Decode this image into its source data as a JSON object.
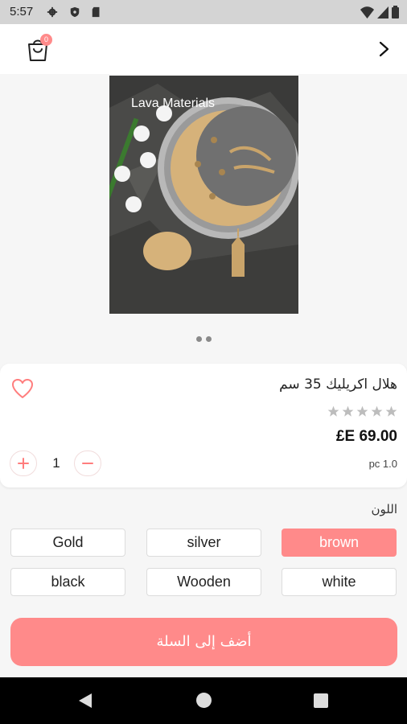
{
  "status_bar": {
    "time": "5:57"
  },
  "app_bar": {
    "cart_count": "0"
  },
  "product_image": {
    "watermark": "Lava Materials",
    "pager_dots": 2
  },
  "product": {
    "name": "هلال اكريليك 35 سم",
    "rating": 0,
    "max_rating": 5,
    "price": "£E 69.00",
    "quantity": "1",
    "unit": "pc 1.0"
  },
  "colors": {
    "label": "اللون",
    "options": [
      "brown",
      "silver",
      "Gold",
      "white",
      "Wooden",
      "black"
    ],
    "selected": "brown"
  },
  "actions": {
    "add_to_cart": "أضف إلى السلة"
  },
  "theme": {
    "accent": "#ff8a8a",
    "star_empty": "#bdbdbd"
  }
}
